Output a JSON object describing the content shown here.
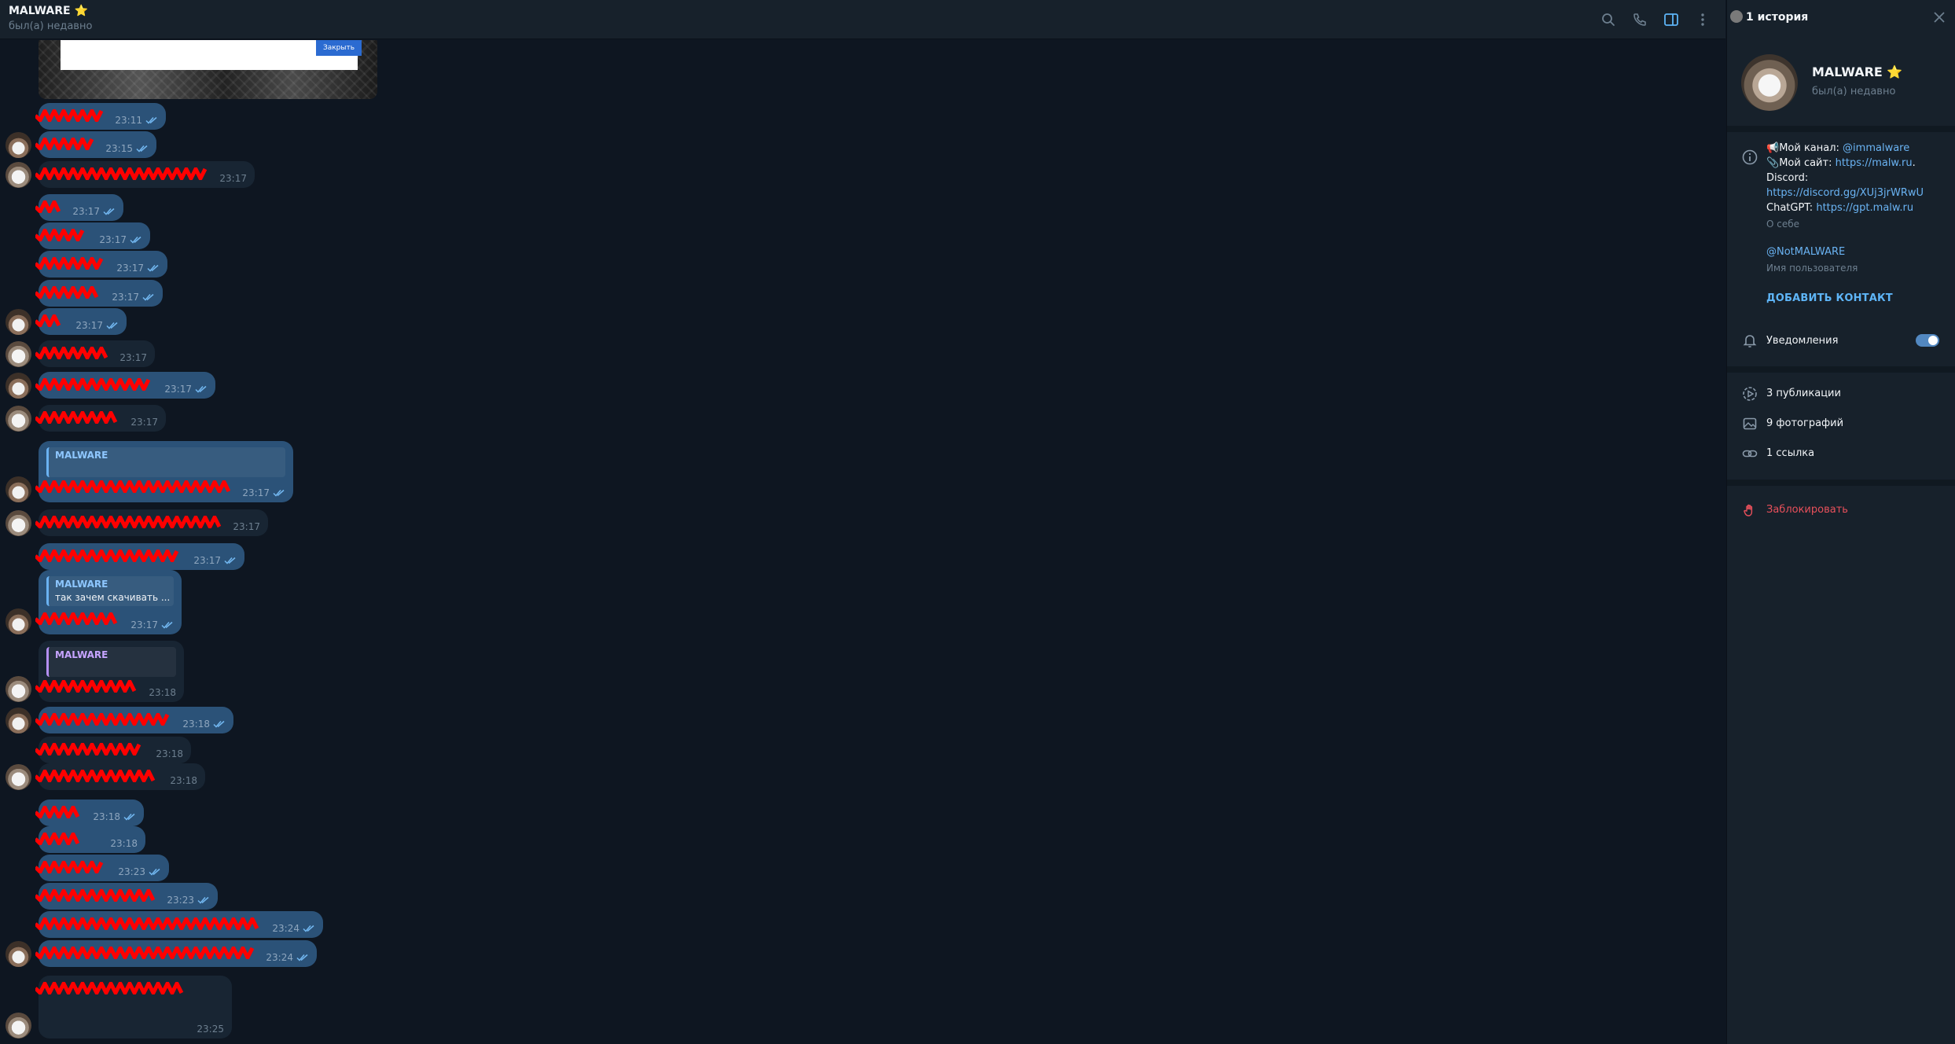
{
  "header": {
    "title": "MALWARE ⭐",
    "status": "был(а) недавно"
  },
  "image_message": {
    "button_label": "Закрыть"
  },
  "messages": [
    {
      "dir": "out",
      "time": "23:11",
      "read": true
    },
    {
      "dir": "out",
      "time": "23:15",
      "read": true
    },
    {
      "dir": "in",
      "time": "23:17"
    },
    {
      "dir": "out",
      "time": "23:17",
      "read": true
    },
    {
      "dir": "out",
      "time": "23:17",
      "read": true
    },
    {
      "dir": "out",
      "time": "23:17",
      "read": true
    },
    {
      "dir": "out",
      "time": "23:17",
      "read": true
    },
    {
      "dir": "out",
      "time": "23:17",
      "read": true
    },
    {
      "dir": "in",
      "time": "23:17"
    },
    {
      "dir": "out",
      "time": "23:17",
      "read": true
    },
    {
      "dir": "in",
      "time": "23:17"
    },
    {
      "dir": "out",
      "time": "23:17",
      "read": true,
      "reply_name": "MALWARE"
    },
    {
      "dir": "in",
      "time": "23:17"
    },
    {
      "dir": "out",
      "time": "23:17",
      "read": true
    },
    {
      "dir": "out",
      "time": "23:17",
      "read": true,
      "reply_name": "MALWARE",
      "reply_text": "так зачем скачивать ..."
    },
    {
      "dir": "in",
      "time": "23:18",
      "reply_name": "MALWARE"
    },
    {
      "dir": "out",
      "time": "23:18",
      "read": true
    },
    {
      "dir": "in",
      "time": "23:18"
    },
    {
      "dir": "in",
      "time": "23:18"
    },
    {
      "dir": "out",
      "time": "23:18",
      "read": true
    },
    {
      "dir": "out",
      "time": "23:18"
    },
    {
      "dir": "out",
      "time": "23:23",
      "read": true
    },
    {
      "dir": "out",
      "time": "23:23",
      "read": true
    },
    {
      "dir": "out",
      "time": "23:24",
      "read": true
    },
    {
      "dir": "out",
      "time": "23:24",
      "read": true
    },
    {
      "dir": "in",
      "time": "23:25"
    }
  ],
  "panel": {
    "stories_label": "1 история",
    "name": "MALWARE ⭐",
    "status": "был(а) недавно",
    "bio": {
      "line1_prefix": "Мой канал: ",
      "line1_link": "@immalware",
      "line2_prefix": "Мой сайт: ",
      "line2_link": "https://malw.ru",
      "line2_suffix": ".",
      "line3": "Discord:",
      "line4_link": "https://discord.gg/XUj3jrWRwU",
      "line5_prefix": " ChatGPT: ",
      "line5_link": "https://gpt.malw.ru",
      "caption": "О себе"
    },
    "username": "@NotMALWARE",
    "username_caption": "Имя пользователя",
    "add_contact": "ДОБАВИТЬ КОНТАКТ",
    "notifications_label": "Уведомления",
    "notifications_on": true,
    "media": {
      "publications": "3 публикации",
      "photos": "9 фотографий",
      "links": "1 ссылка"
    },
    "block_label": "Заблокировать"
  },
  "colors": {
    "chat_bg": "#0e1621",
    "header_bg": "#17212b",
    "bubble_out": "#2b5278",
    "bubble_in": "#182533",
    "link": "#6ab3f3",
    "danger": "#e8505b",
    "redaction": "#ff0000"
  }
}
